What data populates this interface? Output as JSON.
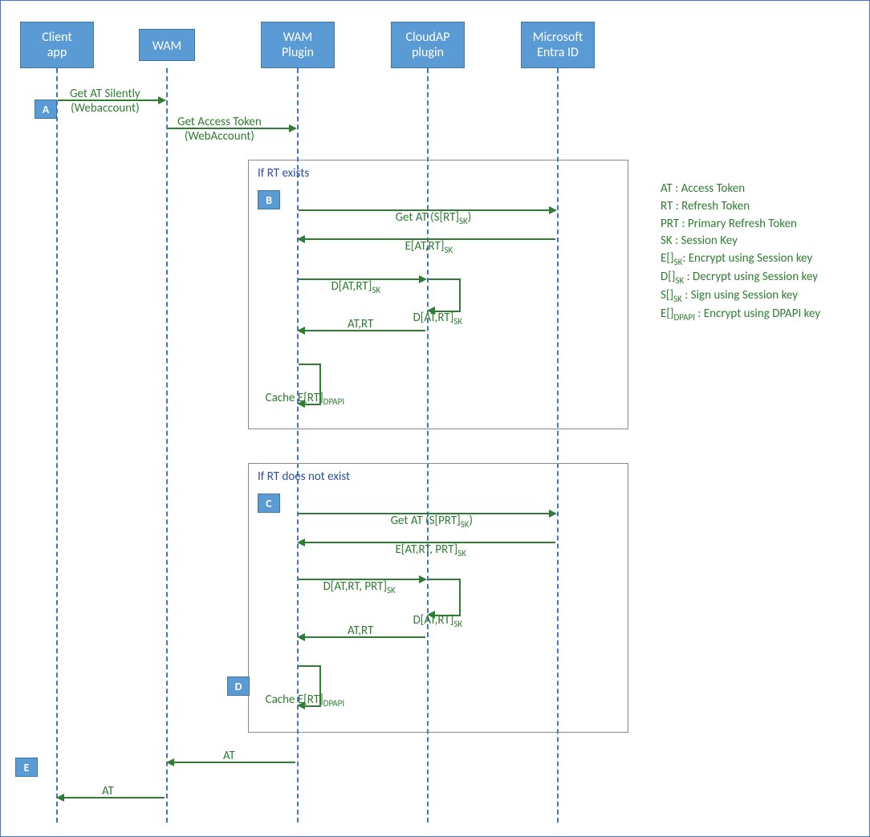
{
  "actors": {
    "client": "Client\napp",
    "wam": "WAM",
    "wam_plugin": "WAM\nPlugin",
    "cloudap": "CloudAP\nplugin",
    "entra": "Microsoft\nEntra ID"
  },
  "steps": {
    "A": "A",
    "B": "B",
    "C": "C",
    "D": "D",
    "E": "E"
  },
  "labels": {
    "get_at_silently": "Get AT Silently\n(Webaccount)",
    "get_access_token": "Get Access Token\n(WebAccount)",
    "box_rt_exists": "If RT exists",
    "b_get_at": "Get AT (S[RT]",
    "b_get_at_sub": "SK",
    "b_get_at_close": ")",
    "b_e_at_rt": "E[AT,RT]",
    "b_d_at_rt": "D[AT,RT]",
    "b_d_at_rt2": "D[AT,RT]",
    "b_at_rt": "AT,RT",
    "b_cache": "Cache E[RT]",
    "b_cache_sub": "DPAPI",
    "box_rt_not": "If RT does not exist",
    "c_get_at": "Get AT (S[PRT]",
    "c_e": "E[AT,RT, PRT]",
    "c_d": "D[AT,RT, PRT]",
    "c_d2": "D[AT,RT]",
    "c_at_rt": "AT,RT",
    "d_cache": "Cache E[RT]",
    "ret_at1": "AT",
    "ret_at2": "AT"
  },
  "legend": {
    "l1": "AT : Access Token",
    "l2": "RT : Refresh Token",
    "l3": "PRT : Primary Refresh Token",
    "l4": "SK : Session Key",
    "l5a": "E[]",
    "l5b": ": Encrypt using Session key",
    "l6a": "D[]",
    "l6b": " : Decrypt using Session key",
    "l7a": "S[]",
    "l7b": " : Sign using Session key",
    "l8a": "E[]",
    "l8sub": "DPAPI",
    "l8b": " : Encrypt using DPAPI key",
    "sk": "SK"
  }
}
